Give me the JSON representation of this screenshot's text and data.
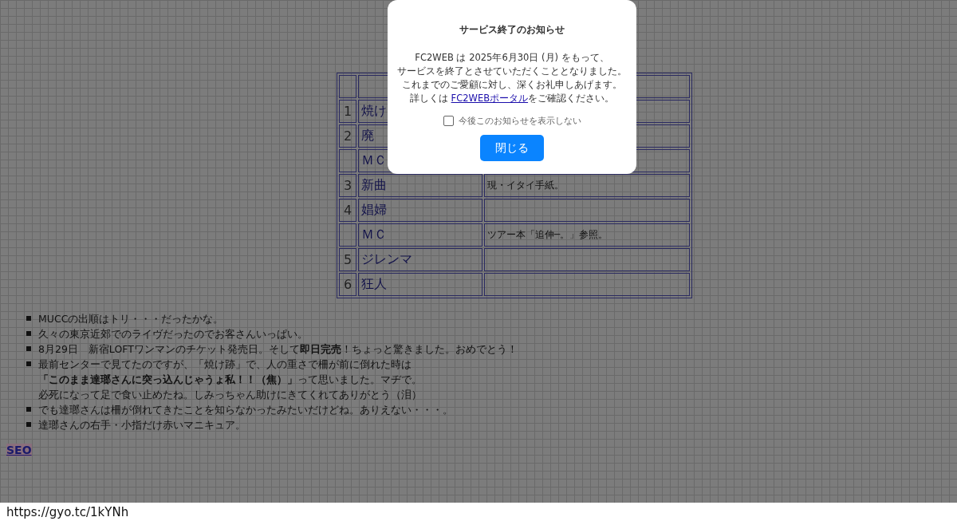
{
  "setlist": {
    "rows": [
      {
        "number": "",
        "song": "",
        "comment": ""
      },
      {
        "number": "1",
        "song": "焼け",
        "comment": ""
      },
      {
        "number": "2",
        "song": "廃",
        "comment": ""
      },
      {
        "number": "",
        "song": "ＭＣ",
        "comment": ""
      },
      {
        "number": "3",
        "song": "新曲",
        "comment": "現・イタイ手紙。"
      },
      {
        "number": "4",
        "song": "娼婦",
        "comment": ""
      },
      {
        "number": "",
        "song": "ＭＣ",
        "comment": "ツアー本「追伸─。」参照。"
      },
      {
        "number": "5",
        "song": "ジレンマ",
        "comment": ""
      },
      {
        "number": "6",
        "song": "狂人",
        "comment": ""
      }
    ]
  },
  "notes": [
    [
      "MUCCの出順はトリ・・・だったかな。"
    ],
    [
      "久々の東京近郊でのライヴだったのでお客さんいっぱい。"
    ],
    [
      "8月29日　新宿LOFTワンマンのチケット発売日。そして**即日完売**！ちょっと驚きました。おめでとう！"
    ],
    [
      "最前センターで見てたのですが、「焼け跡」で、人の重さで柵が前に倒れた時は",
      "**「このまま達瑯さんに突っ込んじゃうょ私！！（焦）」**って思いました。マヂで。",
      "必死になって足で食い止めたね。しみっちゃん助けにきてくれてありがとう（泪）"
    ],
    [
      "でも達瑯さんは柵が倒れてきたことを知らなかったみたいだけどね。ありえない・・・。"
    ],
    [
      "達瑯さんの右手・小指だけ赤いマニキュア。"
    ]
  ],
  "seo_link": "SEO",
  "status_bar": {
    "url": "https://gyo.tc/1kYNh"
  },
  "dialog": {
    "title": "サービス終了のお知らせ",
    "lines": [
      "FC2WEB は 2025年6月30日 (月) をもって、",
      "サービスを終了とさせていただくこととなりました。",
      "これまでのご愛顧に対し、深くお礼申しあげます。"
    ],
    "detail_before": "詳しくは ",
    "detail_link": "FC2WEBポータル",
    "detail_after": "をご確認ください。",
    "checkbox": {
      "label": "今後このお知らせを表示しない",
      "checked": false
    },
    "button": "閉じる"
  }
}
